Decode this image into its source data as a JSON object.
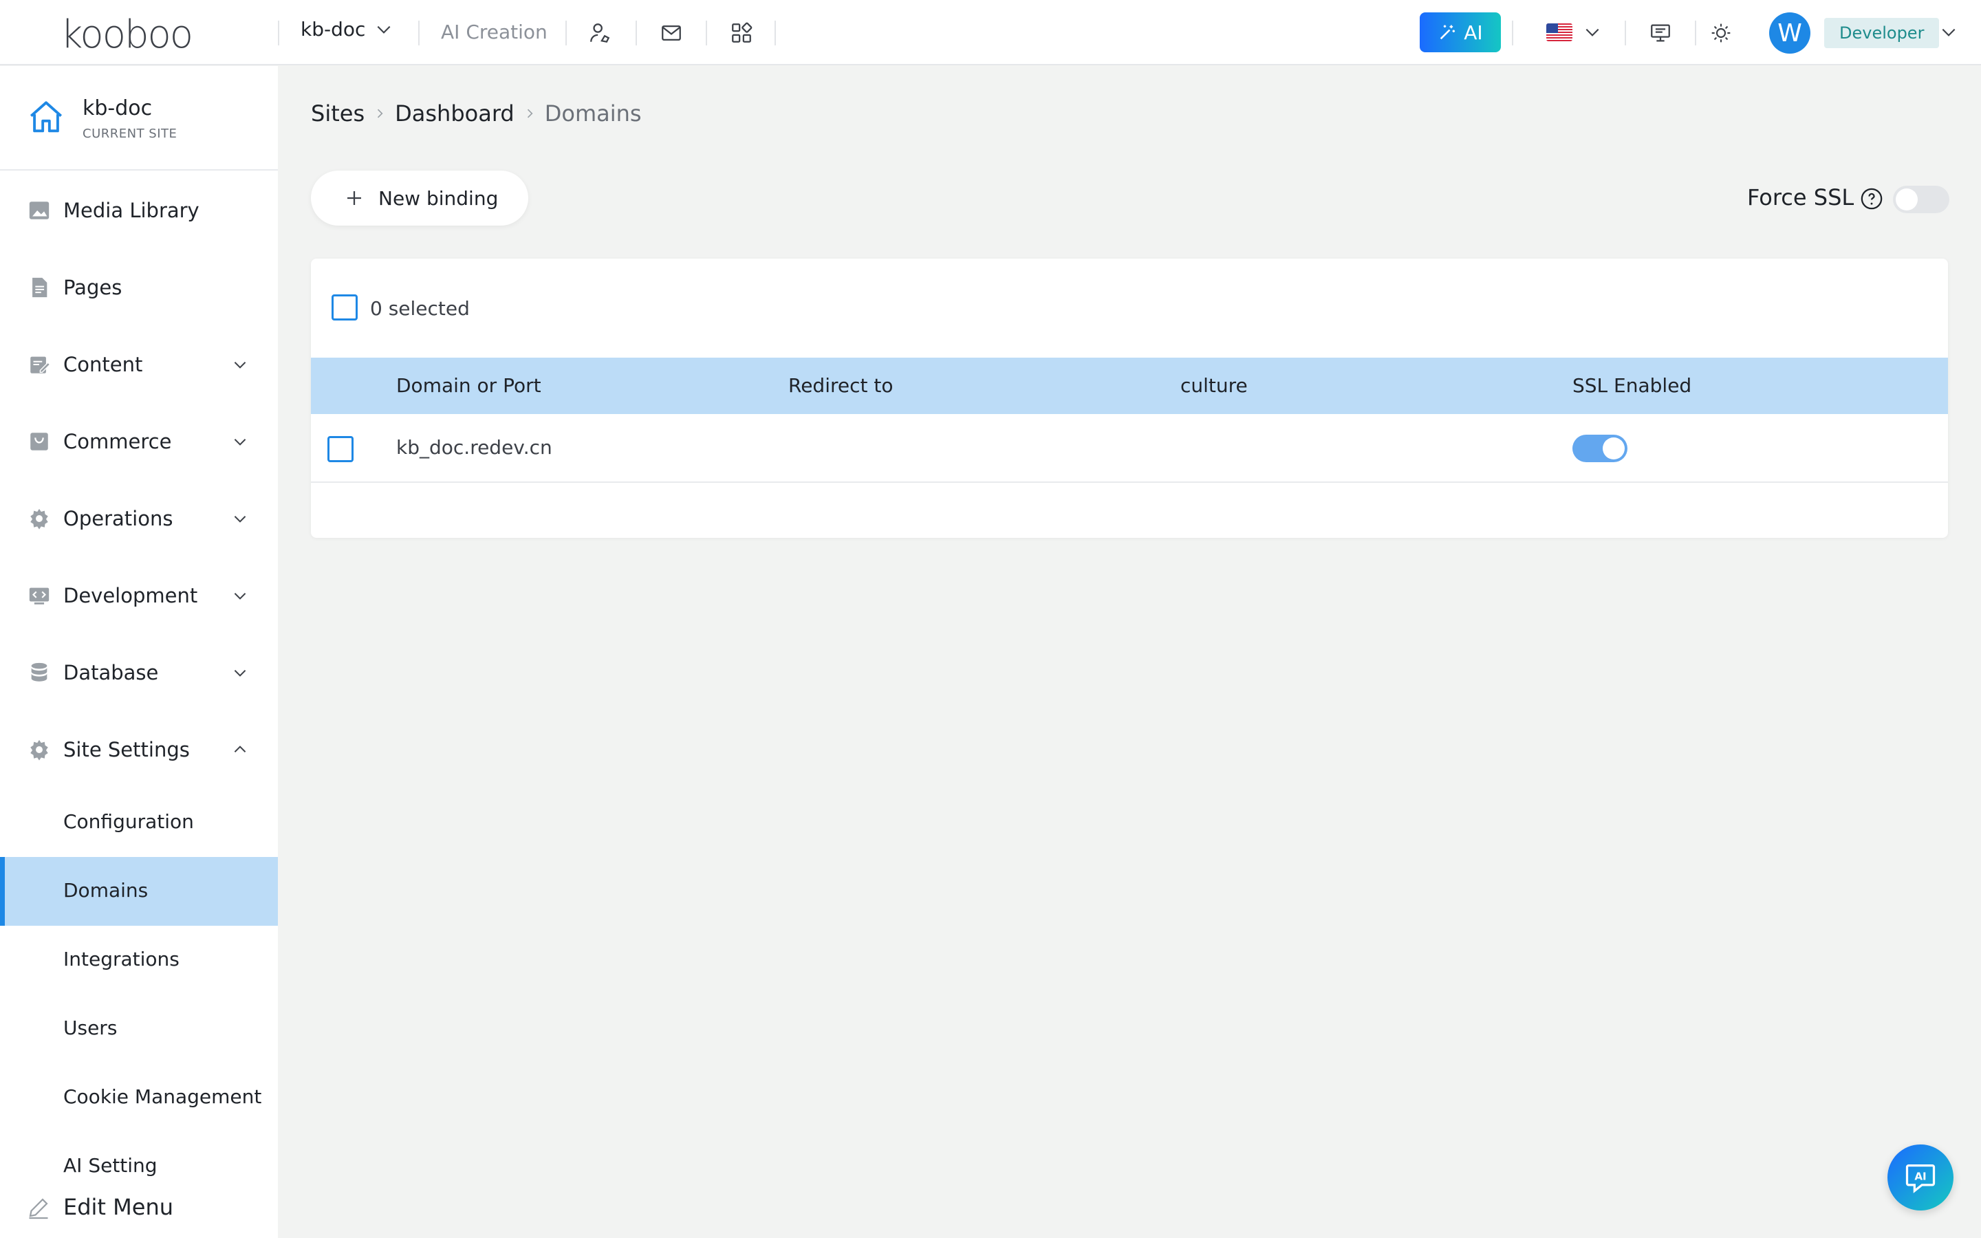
{
  "topbar": {
    "logo": "kooboo",
    "site_selector": "kb-doc",
    "ai_creation": "AI Creation",
    "ai_button": "AI",
    "avatar_letter": "W",
    "role": "Developer",
    "language_flag": "us-flag-icon"
  },
  "sidebar": {
    "current_site_name": "kb-doc",
    "current_site_label": "CURRENT SITE",
    "items": [
      {
        "label": "Media Library",
        "icon": "image-icon"
      },
      {
        "label": "Pages",
        "icon": "page-icon"
      },
      {
        "label": "Content",
        "icon": "content-icon",
        "expandable": true
      },
      {
        "label": "Commerce",
        "icon": "bag-icon",
        "expandable": true
      },
      {
        "label": "Operations",
        "icon": "gear-icon",
        "expandable": true
      },
      {
        "label": "Development",
        "icon": "code-icon",
        "expandable": true
      },
      {
        "label": "Database",
        "icon": "database-icon",
        "expandable": true
      },
      {
        "label": "Site Settings",
        "icon": "gear-icon",
        "expandable": true,
        "expanded": true
      }
    ],
    "sub_items": [
      "Configuration",
      "Domains",
      "Integrations",
      "Users",
      "Cookie Management",
      "AI Setting"
    ],
    "active_sub_item": "Domains",
    "edit_menu": "Edit Menu"
  },
  "breadcrumb": [
    "Sites",
    "Dashboard",
    "Domains"
  ],
  "toolbar": {
    "new_binding": "New binding",
    "force_ssl": "Force SSL",
    "force_ssl_enabled": false
  },
  "table": {
    "selected_text": "0 selected",
    "columns": [
      "Domain or Port",
      "Redirect to",
      "culture",
      "SSL Enabled"
    ],
    "rows": [
      {
        "domain": "kb_doc.redev.cn",
        "redirect": "",
        "culture": "",
        "ssl_enabled": true
      }
    ]
  },
  "colors": {
    "accent": "#1e88e5",
    "active_row": "#bcdcf7",
    "header_row": "#bcdcf7",
    "toggle_on": "#63a7ef"
  }
}
